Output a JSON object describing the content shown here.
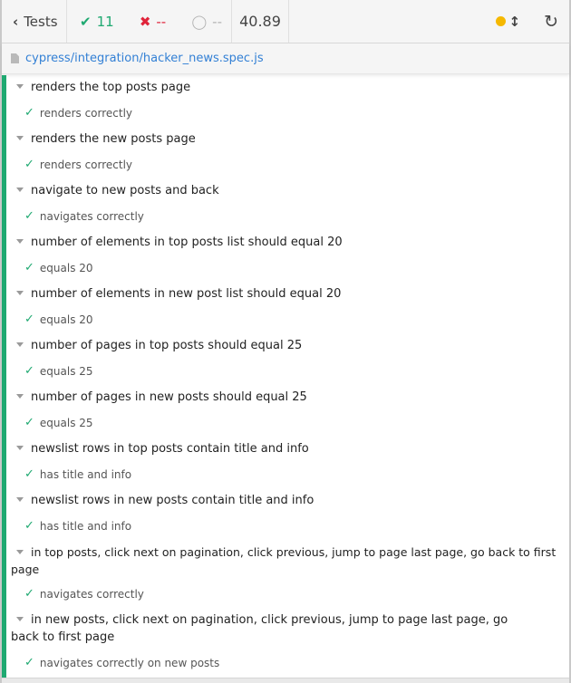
{
  "header": {
    "tests_label": "Tests",
    "passed_count": "11",
    "failed_count": "--",
    "pending_count": "--",
    "duration": "40.89",
    "colors": {
      "passed": "#1fa971",
      "failed": "#e0243a",
      "running": "#f5b800",
      "link": "#3380d5"
    }
  },
  "spec": {
    "path": "cypress/integration/hacker_news.spec.js"
  },
  "suites": [
    {
      "title": "renders the top posts page",
      "test": "renders correctly"
    },
    {
      "title": "renders the new posts page",
      "test": "renders correctly"
    },
    {
      "title": "navigate to new posts and back",
      "test": "navigates correctly"
    },
    {
      "title": "number of elements in top posts list should equal 20",
      "test": "equals 20"
    },
    {
      "title": "number of elements in new post list should equal 20",
      "test": "equals 20"
    },
    {
      "title": "number of pages in top posts should equal 25",
      "test": "equals 25"
    },
    {
      "title": "number of pages in new posts should equal 25",
      "test": "equals 25"
    },
    {
      "title": "newslist rows in top posts contain title and info",
      "test": "has title and info"
    },
    {
      "title": "newslist rows in new posts contain title and info",
      "test": "has title and info"
    },
    {
      "title": "in top posts, click next on pagination, click previous, jump to page last page, go back to first page",
      "test": "navigates correctly"
    },
    {
      "title": "in new posts, click next on pagination, click previous, jump to page last page, go back to first page",
      "test": "navigates correctly on new posts"
    }
  ]
}
